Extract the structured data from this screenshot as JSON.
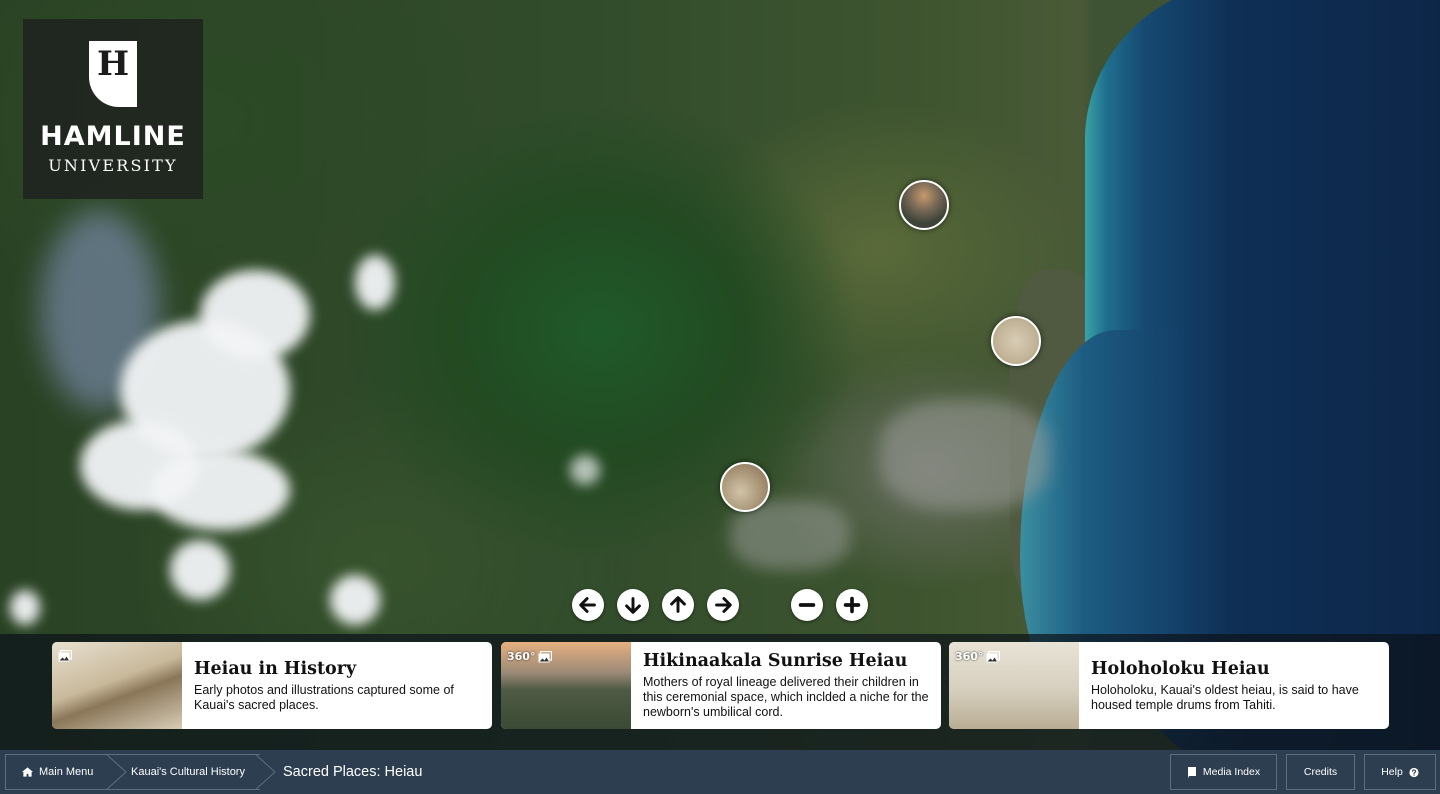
{
  "logo": {
    "mark": "H",
    "name": "HAMLINE",
    "sub": "UNIVERSITY"
  },
  "map": {
    "markers": [
      "marker-hikinaakala-sunrise-heiau",
      "marker-holoholoku-heiau",
      "marker-heiau-in-history"
    ],
    "controls": [
      "arrow-left-icon",
      "arrow-down-icon",
      "arrow-up-icon",
      "arrow-right-icon",
      "zoom-out-icon",
      "zoom-in-icon"
    ]
  },
  "cards": [
    {
      "badge": "",
      "badge_icon": "image-icon",
      "title": "Heiau in History",
      "description": "Early photos and illustrations captured some of Kauai's sacred places."
    },
    {
      "badge": "360°",
      "badge_icon": "image-icon",
      "title": "Hikinaakala Sunrise Heiau",
      "description": "Mothers of royal lineage delivered their children in this ceremonial space, which inclded a niche for the newborn's umbilical cord."
    },
    {
      "badge": "360°",
      "badge_icon": "image-icon",
      "title": "Holoholoku Heiau",
      "description": "Holoholoku, Kauai's oldest heiau, is said to have housed temple drums from Tahiti."
    }
  ],
  "breadcrumb": {
    "home": "Main Menu",
    "section": "Kauai's Cultural History",
    "current": "Sacred Places: Heiau"
  },
  "toolbar": {
    "media_index": "Media Index",
    "credits": "Credits",
    "help": "Help"
  },
  "colors": {
    "bottom_bar": "#2c3e50",
    "card_bg": "#ffffff",
    "nav_button": "#ffffff"
  }
}
